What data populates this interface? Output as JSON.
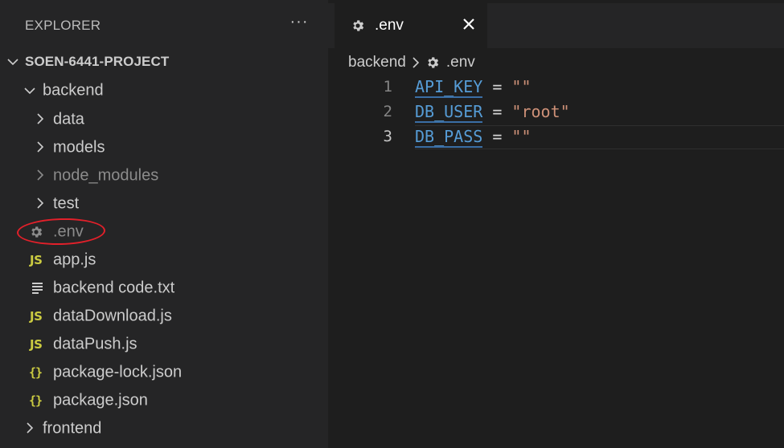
{
  "explorer": {
    "title": "EXPLORER",
    "more_label": "···"
  },
  "tree": {
    "project": "SOEN-6441-PROJECT",
    "backend": "backend",
    "items": [
      "data",
      "models",
      "node_modules",
      "test"
    ],
    "files": [
      ".env",
      "app.js",
      "backend code.txt",
      "dataDownload.js",
      "dataPush.js",
      "package-lock.json",
      "package.json"
    ],
    "frontend": "frontend"
  },
  "icons": {
    "js_label": "JS",
    "json_label": "{}"
  },
  "tab": {
    "label": ".env",
    "close": "✕"
  },
  "breadcrumb": {
    "folder": "backend",
    "file": ".env"
  },
  "code": {
    "line_numbers": [
      "1",
      "2",
      "3"
    ],
    "lines": [
      {
        "key": "API_KEY",
        "op": " = ",
        "value": "\"\""
      },
      {
        "key": "DB_USER",
        "op": " = ",
        "value": "\"root\""
      },
      {
        "key": "DB_PASS",
        "op": " = ",
        "value": "\"\""
      }
    ]
  },
  "colors": {
    "annotation": "#e2202a",
    "keyword": "#569cd6",
    "string": "#ce9178",
    "js_icon": "#cbcb41"
  }
}
